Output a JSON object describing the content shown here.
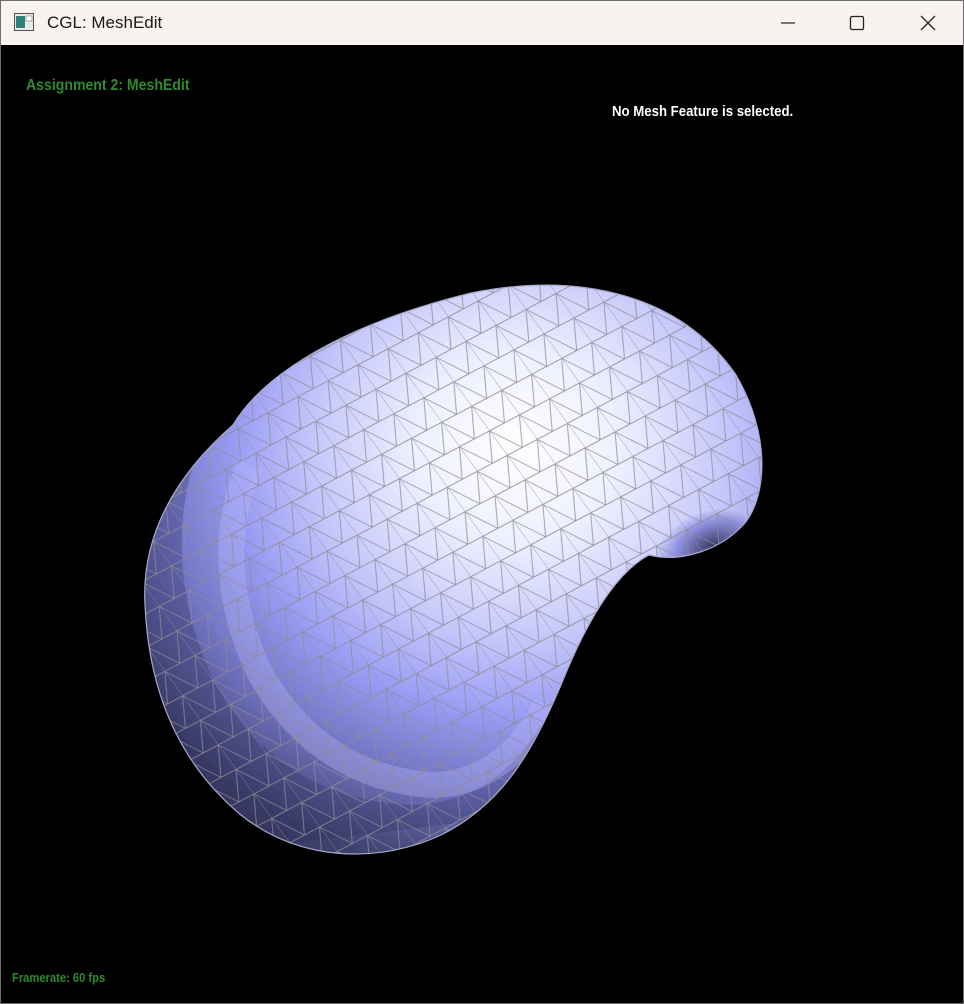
{
  "window": {
    "title": "CGL: MeshEdit",
    "icon": "app-window-icon",
    "controls": {
      "minimize_icon": "minimize-icon",
      "maximize_icon": "maximize-icon",
      "close_icon": "close-icon"
    }
  },
  "viewport": {
    "background": "#000000",
    "assignment_title": "Assignment 2: MeshEdit",
    "selection_status": "No Mesh Feature is selected.",
    "framerate_label": "Framerate: 60 fps"
  },
  "mesh": {
    "fill_light": "#f4f4ff",
    "fill_mid": "#9a9cf4",
    "fill_dark": "#4a4c82",
    "edge_color": "#8c8c96"
  },
  "colors": {
    "overlay_green": "#2e8b2e",
    "overlay_white": "#ffffff",
    "titlebar_bg": "#f9f3ef"
  }
}
